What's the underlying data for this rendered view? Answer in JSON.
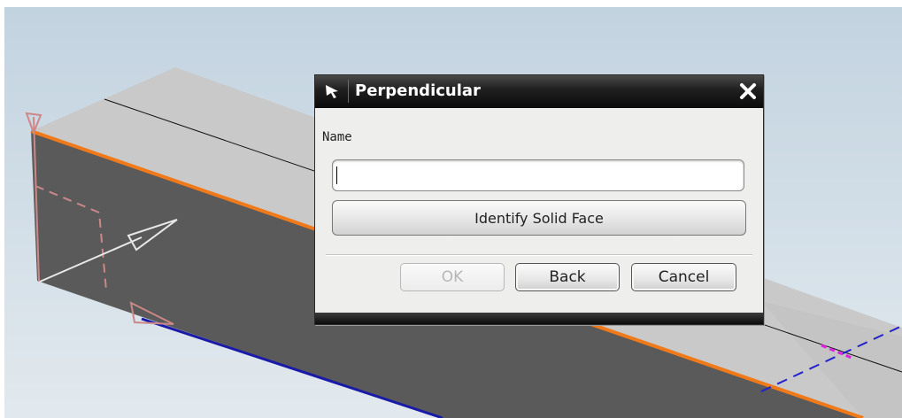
{
  "colors": {
    "background": "#cfdce6",
    "solid_top_face": "#c9c9c9",
    "solid_front_face": "#595959",
    "orange_edge": "#f07a1a",
    "blue_edge": "#1a1aa8",
    "magenta_marker": "#e020e0",
    "sketch_pink": "#cc8888",
    "titlebar": "#1a1a1a"
  },
  "dialog": {
    "title": "Perpendicular",
    "title_icon": "arrow-cursor-icon",
    "close_icon": "close-icon",
    "name_label": "Name",
    "name_value": "",
    "identify_button_label": "Identify Solid Face",
    "ok_label": "OK",
    "back_label": "Back",
    "cancel_label": "Cancel",
    "ok_enabled": false
  }
}
